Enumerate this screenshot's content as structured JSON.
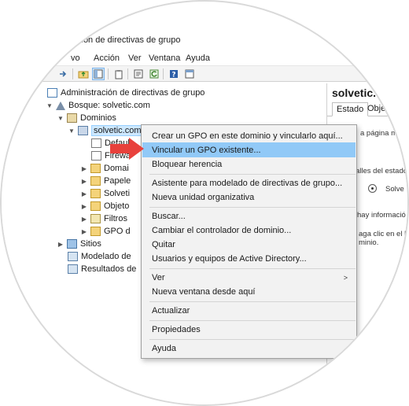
{
  "window": {
    "title": "ción de directivas de grupo"
  },
  "menubar": {
    "items": [
      "vo",
      "Acción",
      "Ver",
      "Ventana",
      "Ayuda"
    ]
  },
  "toolbar": {
    "buttons": [
      "back-icon",
      "forward-icon",
      "up-folder-icon",
      "show-tree-icon",
      "clipboard-icon",
      "properties-icon",
      "refresh-icon",
      "help-icon",
      "view-icon"
    ]
  },
  "tree": {
    "root": "Administración de directivas de grupo",
    "forest": "Bosque: solvetic.com",
    "domains": "Dominios",
    "domain": "solvetic.com",
    "children": [
      "Defaul",
      "Firewa",
      "Domai",
      "Papele",
      "Solveti",
      "Objeto",
      "Filtros",
      "GPO d"
    ],
    "sites": "Sitios",
    "modeling": "Modelado de",
    "results": "Resultados de"
  },
  "rightpane": {
    "title": "solvetic.",
    "tab_estado": "Estado",
    "tab_obj": "Obje",
    "text1": "a página m",
    "text2": "alles del estado",
    "radio_label": "Solve",
    "text3": "hay informació",
    "text4": "aga clic en el b",
    "text5": "minio."
  },
  "context_menu": {
    "items": [
      "Crear un GPO en este dominio y vincularlo aquí...",
      "Vincular un GPO existente...",
      "Bloquear herencia",
      "Asistente para modelado de directivas de grupo...",
      "Nueva unidad organizativa",
      "Buscar...",
      "Cambiar el controlador de dominio...",
      "Quitar",
      "Usuarios y equipos de Active Directory...",
      "Ver",
      "Nueva ventana desde aquí",
      "Actualizar",
      "Propiedades",
      "Ayuda"
    ],
    "highlighted": "Vincular un GPO existente...",
    "submenu_arrow": ">"
  },
  "colors": {
    "highlight": "#91c9f7",
    "pointer": "#e8413c",
    "selection": "#cde8ff"
  }
}
